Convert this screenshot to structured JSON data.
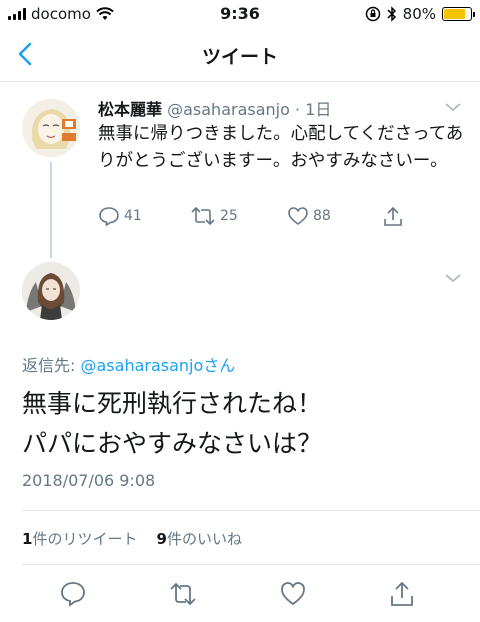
{
  "status_bar": {
    "carrier": "docomo",
    "time": "9:36",
    "battery": "80%",
    "battery_level": 0.8
  },
  "nav": {
    "title": "ツイート"
  },
  "parent_tweet": {
    "name": "松本麗華",
    "handle_time": "@asaharasanjo · 1日",
    "text": "無事に帰りつきました。心配してくださってありがとうございますー。おやすみなさいー。",
    "reply_count": "41",
    "retweet_count": "25",
    "like_count": "88"
  },
  "reply_tweet": {
    "reply_label": "返信先:",
    "reply_handle": "@asaharasanjo",
    "reply_suffix": "さん",
    "text_line1": "無事に死刑執行されたね！",
    "text_line2": "パパにおやすみなさいは？",
    "timestamp": "2018/07/06 9:08",
    "retweets_num": "1",
    "retweets_label": "件のリツイート",
    "likes_num": "9",
    "likes_label": "件のいいね"
  },
  "colors": {
    "accent": "#1da1f2",
    "secondary_text": "#657786",
    "battery": "#f5c400"
  }
}
